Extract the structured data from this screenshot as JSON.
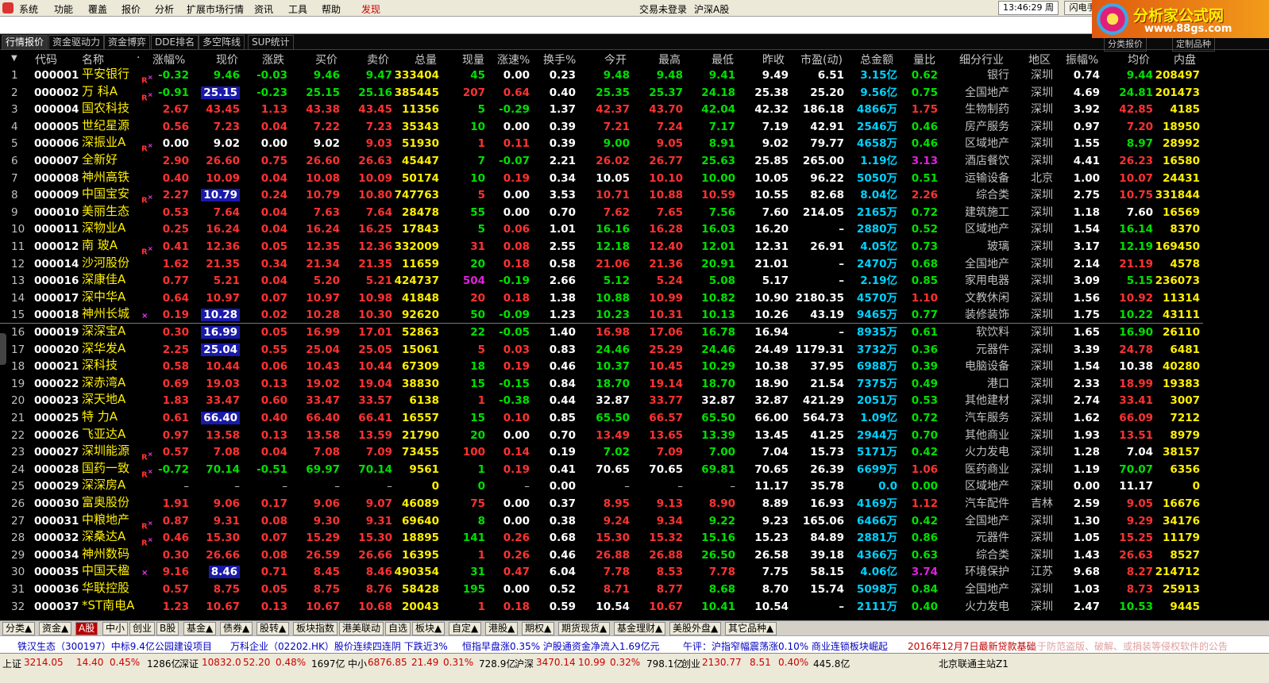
{
  "menu": {
    "items": [
      "系统",
      "功能",
      "覆盖",
      "报价",
      "分析",
      "扩展市场行情",
      "资讯",
      "工具",
      "帮助"
    ],
    "discover": "发现",
    "trade_status": "交易未登录",
    "market": "沪深A股",
    "clock": "13:46:29 周三",
    "flash_btn": "闪电手",
    "next_btn": "行"
  },
  "brand": {
    "title": "分析家公式网",
    "url": "www.88gs.com"
  },
  "tabs": [
    "行情报价",
    "资金驱动力",
    "资金博弈",
    "DDE排名",
    "多空阵线",
    "SUP统计"
  ],
  "right_tabs": [
    "分类报价",
    "定制品种"
  ],
  "columns": [
    "代码",
    "名称",
    "·",
    "涨幅%",
    "现价",
    "涨跌",
    "买价",
    "卖价",
    "总量",
    "现量",
    "涨速%",
    "换手%",
    "今开",
    "最高",
    "最低",
    "昨收",
    "市盈(动)",
    "总金额",
    "量比",
    "细分行业",
    "地区",
    "振幅%",
    "均价",
    "内盘"
  ],
  "rows": [
    {
      "i": "1",
      "code": "000001",
      "name": "平安银行",
      "flag": "R",
      "pct": "-0.32",
      "price": "9.46",
      "chg": "-0.03",
      "bid": "9.46",
      "ask": "9.47",
      "vol": "333404",
      "cur": "45",
      "spd": "0.00",
      "turn": "0.23",
      "open": "9.48",
      "high": "9.48",
      "low": "9.41",
      "prev": "9.49",
      "pe": "6.51",
      "amt": "3.15亿",
      "vr": "0.62",
      "ind": "银行",
      "reg": "深圳",
      "amp": "0.74",
      "avg": "9.44",
      "inner": "208497"
    },
    {
      "i": "2",
      "code": "000002",
      "name": "万 科A",
      "flag": "R",
      "pct": "-0.91",
      "price": "25.15",
      "chg": "-0.23",
      "bid": "25.15",
      "ask": "25.16",
      "vol": "385445",
      "cur": "207",
      "spd": "0.64",
      "turn": "0.40",
      "open": "25.35",
      "high": "25.37",
      "low": "24.18",
      "prev": "25.38",
      "pe": "25.20",
      "amt": "9.56亿",
      "vr": "0.75",
      "ind": "全国地产",
      "reg": "深圳",
      "amp": "4.69",
      "avg": "24.81",
      "inner": "201473"
    },
    {
      "i": "3",
      "code": "000004",
      "name": "国农科技",
      "flag": "",
      "pct": "2.67",
      "price": "43.45",
      "chg": "1.13",
      "bid": "43.38",
      "ask": "43.45",
      "vol": "11356",
      "cur": "5",
      "spd": "-0.29",
      "turn": "1.37",
      "open": "42.37",
      "high": "43.70",
      "low": "42.04",
      "prev": "42.32",
      "pe": "186.18",
      "amt": "4866万",
      "vr": "1.75",
      "ind": "生物制药",
      "reg": "深圳",
      "amp": "3.92",
      "avg": "42.85",
      "inner": "4185"
    },
    {
      "i": "4",
      "code": "000005",
      "name": "世纪星源",
      "flag": "",
      "pct": "0.56",
      "price": "7.23",
      "chg": "0.04",
      "bid": "7.22",
      "ask": "7.23",
      "vol": "35343",
      "cur": "10",
      "spd": "0.00",
      "turn": "0.39",
      "open": "7.21",
      "high": "7.24",
      "low": "7.17",
      "prev": "7.19",
      "pe": "42.91",
      "amt": "2546万",
      "vr": "0.46",
      "ind": "房产服务",
      "reg": "深圳",
      "amp": "0.97",
      "avg": "7.20",
      "inner": "18950"
    },
    {
      "i": "5",
      "code": "000006",
      "name": "深振业A",
      "flag": "R",
      "pct": "0.00",
      "price": "9.02",
      "chg": "0.00",
      "bid": "9.02",
      "ask": "9.03",
      "vol": "51930",
      "cur": "1",
      "spd": "0.11",
      "turn": "0.39",
      "open": "9.00",
      "high": "9.05",
      "low": "8.91",
      "prev": "9.02",
      "pe": "79.77",
      "amt": "4658万",
      "vr": "0.46",
      "ind": "区域地产",
      "reg": "深圳",
      "amp": "1.55",
      "avg": "8.97",
      "inner": "28992"
    },
    {
      "i": "6",
      "code": "000007",
      "name": "全新好",
      "flag": "",
      "pct": "2.90",
      "price": "26.60",
      "chg": "0.75",
      "bid": "26.60",
      "ask": "26.63",
      "vol": "45447",
      "cur": "7",
      "spd": "-0.07",
      "turn": "2.21",
      "open": "26.02",
      "high": "26.77",
      "low": "25.63",
      "prev": "25.85",
      "pe": "265.00",
      "amt": "1.19亿",
      "vr": "3.13",
      "ind": "酒店餐饮",
      "reg": "深圳",
      "amp": "4.41",
      "avg": "26.23",
      "inner": "16580"
    },
    {
      "i": "7",
      "code": "000008",
      "name": "神州高铁",
      "flag": "",
      "pct": "0.40",
      "price": "10.09",
      "chg": "0.04",
      "bid": "10.08",
      "ask": "10.09",
      "vol": "50174",
      "cur": "10",
      "spd": "0.19",
      "turn": "0.34",
      "open": "10.05",
      "high": "10.10",
      "low": "10.00",
      "prev": "10.05",
      "pe": "96.22",
      "amt": "5050万",
      "vr": "0.51",
      "ind": "运输设备",
      "reg": "北京",
      "amp": "1.00",
      "avg": "10.07",
      "inner": "24431"
    },
    {
      "i": "8",
      "code": "000009",
      "name": "中国宝安",
      "flag": "R",
      "pct": "2.27",
      "price": "10.79",
      "chg": "0.24",
      "bid": "10.79",
      "ask": "10.80",
      "vol": "747763",
      "cur": "5",
      "spd": "0.00",
      "turn": "3.53",
      "open": "10.71",
      "high": "10.88",
      "low": "10.59",
      "prev": "10.55",
      "pe": "82.68",
      "amt": "8.04亿",
      "vr": "2.26",
      "ind": "综合类",
      "reg": "深圳",
      "amp": "2.75",
      "avg": "10.75",
      "inner": "331844"
    },
    {
      "i": "9",
      "code": "000010",
      "name": "美丽生态",
      "flag": "",
      "pct": "0.53",
      "price": "7.64",
      "chg": "0.04",
      "bid": "7.63",
      "ask": "7.64",
      "vol": "28478",
      "cur": "55",
      "spd": "0.00",
      "turn": "0.70",
      "open": "7.62",
      "high": "7.65",
      "low": "7.56",
      "prev": "7.60",
      "pe": "214.05",
      "amt": "2165万",
      "vr": "0.72",
      "ind": "建筑施工",
      "reg": "深圳",
      "amp": "1.18",
      "avg": "7.60",
      "inner": "16569"
    },
    {
      "i": "10",
      "code": "000011",
      "name": "深物业A",
      "flag": "",
      "pct": "0.25",
      "price": "16.24",
      "chg": "0.04",
      "bid": "16.24",
      "ask": "16.25",
      "vol": "17843",
      "cur": "5",
      "spd": "0.06",
      "turn": "1.01",
      "open": "16.16",
      "high": "16.28",
      "low": "16.03",
      "prev": "16.20",
      "pe": "–",
      "amt": "2880万",
      "vr": "0.52",
      "ind": "区域地产",
      "reg": "深圳",
      "amp": "1.54",
      "avg": "16.14",
      "inner": "8370"
    },
    {
      "i": "11",
      "code": "000012",
      "name": "南 玻A",
      "flag": "R",
      "pct": "0.41",
      "price": "12.36",
      "chg": "0.05",
      "bid": "12.35",
      "ask": "12.36",
      "vol": "332009",
      "cur": "31",
      "spd": "0.08",
      "turn": "2.55",
      "open": "12.18",
      "high": "12.40",
      "low": "12.01",
      "prev": "12.31",
      "pe": "26.91",
      "amt": "4.05亿",
      "vr": "0.73",
      "ind": "玻璃",
      "reg": "深圳",
      "amp": "3.17",
      "avg": "12.19",
      "inner": "169450"
    },
    {
      "i": "12",
      "code": "000014",
      "name": "沙河股份",
      "flag": "",
      "pct": "1.62",
      "price": "21.35",
      "chg": "0.34",
      "bid": "21.34",
      "ask": "21.35",
      "vol": "11659",
      "cur": "20",
      "spd": "0.18",
      "turn": "0.58",
      "open": "21.06",
      "high": "21.36",
      "low": "20.91",
      "prev": "21.01",
      "pe": "–",
      "amt": "2470万",
      "vr": "0.68",
      "ind": "全国地产",
      "reg": "深圳",
      "amp": "2.14",
      "avg": "21.19",
      "inner": "4578"
    },
    {
      "i": "13",
      "code": "000016",
      "name": "深康佳A",
      "flag": "",
      "pct": "0.77",
      "price": "5.21",
      "chg": "0.04",
      "bid": "5.20",
      "ask": "5.21",
      "vol": "424737",
      "cur": "504",
      "spd": "-0.19",
      "turn": "2.66",
      "open": "5.12",
      "high": "5.24",
      "low": "5.08",
      "prev": "5.17",
      "pe": "–",
      "amt": "2.19亿",
      "vr": "0.85",
      "ind": "家用电器",
      "reg": "深圳",
      "amp": "3.09",
      "avg": "5.15",
      "inner": "236073"
    },
    {
      "i": "14",
      "code": "000017",
      "name": "深中华A",
      "flag": "",
      "pct": "0.64",
      "price": "10.97",
      "chg": "0.07",
      "bid": "10.97",
      "ask": "10.98",
      "vol": "41848",
      "cur": "20",
      "spd": "0.18",
      "turn": "1.38",
      "open": "10.88",
      "high": "10.99",
      "low": "10.82",
      "prev": "10.90",
      "pe": "2180.35",
      "amt": "4570万",
      "vr": "1.10",
      "ind": "文教休闲",
      "reg": "深圳",
      "amp": "1.56",
      "avg": "10.92",
      "inner": "11314"
    },
    {
      "i": "15",
      "code": "000018",
      "name": "神州长城",
      "flag": "x",
      "pct": "0.19",
      "price": "10.28",
      "chg": "0.02",
      "bid": "10.28",
      "ask": "10.30",
      "vol": "92620",
      "cur": "50",
      "spd": "-0.09",
      "turn": "1.23",
      "open": "10.23",
      "high": "10.31",
      "low": "10.13",
      "prev": "10.26",
      "pe": "43.19",
      "amt": "9465万",
      "vr": "0.77",
      "ind": "装修装饰",
      "reg": "深圳",
      "amp": "1.75",
      "avg": "10.22",
      "inner": "43111"
    },
    {
      "i": "16",
      "code": "000019",
      "name": "深深宝A",
      "flag": "",
      "pct": "0.30",
      "price": "16.99",
      "chg": "0.05",
      "bid": "16.99",
      "ask": "17.01",
      "vol": "52863",
      "cur": "22",
      "spd": "-0.05",
      "turn": "1.40",
      "open": "16.98",
      "high": "17.06",
      "low": "16.78",
      "prev": "16.94",
      "pe": "–",
      "amt": "8935万",
      "vr": "0.61",
      "ind": "软饮料",
      "reg": "深圳",
      "amp": "1.65",
      "avg": "16.90",
      "inner": "26110"
    },
    {
      "i": "17",
      "code": "000020",
      "name": "深华发A",
      "flag": "",
      "pct": "2.25",
      "price": "25.04",
      "chg": "0.55",
      "bid": "25.04",
      "ask": "25.05",
      "vol": "15061",
      "cur": "5",
      "spd": "0.03",
      "turn": "0.83",
      "open": "24.46",
      "high": "25.29",
      "low": "24.46",
      "prev": "24.49",
      "pe": "1179.31",
      "amt": "3732万",
      "vr": "0.36",
      "ind": "元器件",
      "reg": "深圳",
      "amp": "3.39",
      "avg": "24.78",
      "inner": "6481"
    },
    {
      "i": "18",
      "code": "000021",
      "name": "深科技",
      "flag": "",
      "pct": "0.58",
      "price": "10.44",
      "chg": "0.06",
      "bid": "10.43",
      "ask": "10.44",
      "vol": "67309",
      "cur": "18",
      "spd": "0.19",
      "turn": "0.46",
      "open": "10.37",
      "high": "10.45",
      "low": "10.29",
      "prev": "10.38",
      "pe": "37.95",
      "amt": "6988万",
      "vr": "0.39",
      "ind": "电脑设备",
      "reg": "深圳",
      "amp": "1.54",
      "avg": "10.38",
      "inner": "40280"
    },
    {
      "i": "19",
      "code": "000022",
      "name": "深赤湾A",
      "flag": "",
      "pct": "0.69",
      "price": "19.03",
      "chg": "0.13",
      "bid": "19.02",
      "ask": "19.04",
      "vol": "38830",
      "cur": "15",
      "spd": "-0.15",
      "turn": "0.84",
      "open": "18.70",
      "high": "19.14",
      "low": "18.70",
      "prev": "18.90",
      "pe": "21.54",
      "amt": "7375万",
      "vr": "0.49",
      "ind": "港口",
      "reg": "深圳",
      "amp": "2.33",
      "avg": "18.99",
      "inner": "19383"
    },
    {
      "i": "20",
      "code": "000023",
      "name": "深天地A",
      "flag": "",
      "pct": "1.83",
      "price": "33.47",
      "chg": "0.60",
      "bid": "33.47",
      "ask": "33.57",
      "vol": "6138",
      "cur": "1",
      "spd": "-0.38",
      "turn": "0.44",
      "open": "32.87",
      "high": "33.77",
      "low": "32.87",
      "prev": "32.87",
      "pe": "421.29",
      "amt": "2051万",
      "vr": "0.53",
      "ind": "其他建材",
      "reg": "深圳",
      "amp": "2.74",
      "avg": "33.41",
      "inner": "3007"
    },
    {
      "i": "21",
      "code": "000025",
      "name": "特 力A",
      "flag": "",
      "pct": "0.61",
      "price": "66.40",
      "chg": "0.40",
      "bid": "66.40",
      "ask": "66.41",
      "vol": "16557",
      "cur": "15",
      "spd": "0.10",
      "turn": "0.85",
      "open": "65.50",
      "high": "66.57",
      "low": "65.50",
      "prev": "66.00",
      "pe": "564.73",
      "amt": "1.09亿",
      "vr": "0.72",
      "ind": "汽车服务",
      "reg": "深圳",
      "amp": "1.62",
      "avg": "66.09",
      "inner": "7212"
    },
    {
      "i": "22",
      "code": "000026",
      "name": "飞亚达A",
      "flag": "",
      "pct": "0.97",
      "price": "13.58",
      "chg": "0.13",
      "bid": "13.58",
      "ask": "13.59",
      "vol": "21790",
      "cur": "20",
      "spd": "0.00",
      "turn": "0.70",
      "open": "13.49",
      "high": "13.65",
      "low": "13.39",
      "prev": "13.45",
      "pe": "41.25",
      "amt": "2944万",
      "vr": "0.70",
      "ind": "其他商业",
      "reg": "深圳",
      "amp": "1.93",
      "avg": "13.51",
      "inner": "8979"
    },
    {
      "i": "23",
      "code": "000027",
      "name": "深圳能源",
      "flag": "R",
      "pct": "0.57",
      "price": "7.08",
      "chg": "0.04",
      "bid": "7.08",
      "ask": "7.09",
      "vol": "73455",
      "cur": "100",
      "spd": "0.14",
      "turn": "0.19",
      "open": "7.02",
      "high": "7.09",
      "low": "7.00",
      "prev": "7.04",
      "pe": "15.73",
      "amt": "5171万",
      "vr": "0.42",
      "ind": "火力发电",
      "reg": "深圳",
      "amp": "1.28",
      "avg": "7.04",
      "inner": "38157"
    },
    {
      "i": "24",
      "code": "000028",
      "name": "国药一致",
      "flag": "R",
      "pct": "-0.72",
      "price": "70.14",
      "chg": "-0.51",
      "bid": "69.97",
      "ask": "70.14",
      "vol": "9561",
      "cur": "1",
      "spd": "0.19",
      "turn": "0.41",
      "open": "70.65",
      "high": "70.65",
      "low": "69.81",
      "prev": "70.65",
      "pe": "26.39",
      "amt": "6699万",
      "vr": "1.06",
      "ind": "医药商业",
      "reg": "深圳",
      "amp": "1.19",
      "avg": "70.07",
      "inner": "6356"
    },
    {
      "i": "25",
      "code": "000029",
      "name": "深深房A",
      "flag": "",
      "pct": "–",
      "price": "–",
      "chg": "–",
      "bid": "–",
      "ask": "–",
      "vol": "0",
      "cur": "0",
      "spd": "–",
      "turn": "0.00",
      "open": "–",
      "high": "–",
      "low": "–",
      "prev": "11.17",
      "pe": "35.78",
      "amt": "0.0",
      "vr": "0.00",
      "ind": "区域地产",
      "reg": "深圳",
      "amp": "0.00",
      "avg": "11.17",
      "inner": "0"
    },
    {
      "i": "26",
      "code": "000030",
      "name": "富奥股份",
      "flag": "",
      "pct": "1.91",
      "price": "9.06",
      "chg": "0.17",
      "bid": "9.06",
      "ask": "9.07",
      "vol": "46089",
      "cur": "75",
      "spd": "0.00",
      "turn": "0.37",
      "open": "8.95",
      "high": "9.13",
      "low": "8.90",
      "prev": "8.89",
      "pe": "16.93",
      "amt": "4169万",
      "vr": "1.12",
      "ind": "汽车配件",
      "reg": "吉林",
      "amp": "2.59",
      "avg": "9.05",
      "inner": "16676"
    },
    {
      "i": "27",
      "code": "000031",
      "name": "中粮地产",
      "flag": "R",
      "pct": "0.87",
      "price": "9.31",
      "chg": "0.08",
      "bid": "9.30",
      "ask": "9.31",
      "vol": "69640",
      "cur": "8",
      "spd": "0.00",
      "turn": "0.38",
      "open": "9.24",
      "high": "9.34",
      "low": "9.22",
      "prev": "9.23",
      "pe": "165.06",
      "amt": "6466万",
      "vr": "0.42",
      "ind": "全国地产",
      "reg": "深圳",
      "amp": "1.30",
      "avg": "9.29",
      "inner": "34176"
    },
    {
      "i": "28",
      "code": "000032",
      "name": "深桑达A",
      "flag": "R",
      "pct": "0.46",
      "price": "15.30",
      "chg": "0.07",
      "bid": "15.29",
      "ask": "15.30",
      "vol": "18895",
      "cur": "141",
      "spd": "0.26",
      "turn": "0.68",
      "open": "15.30",
      "high": "15.32",
      "low": "15.16",
      "prev": "15.23",
      "pe": "84.89",
      "amt": "2881万",
      "vr": "0.86",
      "ind": "元器件",
      "reg": "深圳",
      "amp": "1.05",
      "avg": "15.25",
      "inner": "11179"
    },
    {
      "i": "29",
      "code": "000034",
      "name": "神州数码",
      "flag": "",
      "pct": "0.30",
      "price": "26.66",
      "chg": "0.08",
      "bid": "26.59",
      "ask": "26.66",
      "vol": "16395",
      "cur": "1",
      "spd": "0.26",
      "turn": "0.46",
      "open": "26.88",
      "high": "26.88",
      "low": "26.50",
      "prev": "26.58",
      "pe": "39.18",
      "amt": "4366万",
      "vr": "0.63",
      "ind": "综合类",
      "reg": "深圳",
      "amp": "1.43",
      "avg": "26.63",
      "inner": "8527"
    },
    {
      "i": "30",
      "code": "000035",
      "name": "中国天楹",
      "flag": "x",
      "pct": "9.16",
      "price": "8.46",
      "chg": "0.71",
      "bid": "8.45",
      "ask": "8.46",
      "vol": "490354",
      "cur": "31",
      "spd": "0.47",
      "turn": "6.04",
      "open": "7.78",
      "high": "8.53",
      "low": "7.78",
      "prev": "7.75",
      "pe": "58.15",
      "amt": "4.06亿",
      "vr": "3.74",
      "ind": "环境保护",
      "reg": "江苏",
      "amp": "9.68",
      "avg": "8.27",
      "inner": "214712"
    },
    {
      "i": "31",
      "code": "000036",
      "name": "华联控股",
      "flag": "",
      "pct": "0.57",
      "price": "8.75",
      "chg": "0.05",
      "bid": "8.75",
      "ask": "8.76",
      "vol": "58428",
      "cur": "195",
      "spd": "0.00",
      "turn": "0.52",
      "open": "8.71",
      "high": "8.77",
      "low": "8.68",
      "prev": "8.70",
      "pe": "15.74",
      "amt": "5098万",
      "vr": "0.84",
      "ind": "全国地产",
      "reg": "深圳",
      "amp": "1.03",
      "avg": "8.73",
      "inner": "25913"
    },
    {
      "i": "32",
      "code": "000037",
      "name": "*ST南电A",
      "flag": "",
      "pct": "1.23",
      "price": "10.67",
      "chg": "0.13",
      "bid": "10.67",
      "ask": "10.68",
      "vol": "20043",
      "cur": "1",
      "spd": "0.18",
      "turn": "0.59",
      "open": "10.54",
      "high": "10.67",
      "low": "10.41",
      "prev": "10.54",
      "pe": "–",
      "amt": "2111万",
      "vr": "0.40",
      "ind": "火力发电",
      "reg": "深圳",
      "amp": "2.47",
      "avg": "10.53",
      "inner": "9445"
    }
  ],
  "bottom_tabs": [
    "分类▲",
    "资金▲",
    "A股",
    "中小",
    "创业",
    "B股",
    "基金▲",
    "债券▲",
    "股转▲",
    "板块指数",
    "港美联动",
    "自选",
    "板块▲",
    "自定▲",
    "港股▲",
    "期权▲",
    "期货现货▲",
    "基金理财▲",
    "美股外盘▲",
    "其它品种▲"
  ],
  "news": [
    "铁汉生态（300197）中标9.4亿公园建设项目",
    "万科企业（02202.HK）股价连续四连阴 下跌近3%",
    "恒指早盘涨0.35% 沪股通资金净流入1.69亿元",
    "午评：沪指窄幅震荡涨0.10% 商业连锁板块崛起",
    "2016年12月7日最新贷款基础",
    "关于防范盗版、破解、或捐装等侵权软件的公告"
  ],
  "ticker": {
    "sh_label": "上证",
    "sh": "3214.05",
    "sh_chg": "14.40",
    "sh_pct": "0.45%",
    "sh_amt": "1286亿",
    "sz_label": "深证",
    "sz": "10832.0",
    "sz_chg": "52.20",
    "sz_pct": "0.48%",
    "sz_amt": "1697亿",
    "zx_label": "中小",
    "zx": "6876.85",
    "zx_chg": "21.49",
    "zx_pct": "0.31%",
    "zx_amt": "728.9亿",
    "hs_label": "沪深",
    "hs": "3470.14",
    "hs_chg": "10.99",
    "hs_pct": "0.32%",
    "hs_amt": "798.1亿",
    "cy_label": "创业",
    "cy": "2130.77",
    "cy_chg": "8.51",
    "cy_pct": "0.40%",
    "cy_amt": "445.8亿",
    "server": "北京联通主站Z1"
  }
}
